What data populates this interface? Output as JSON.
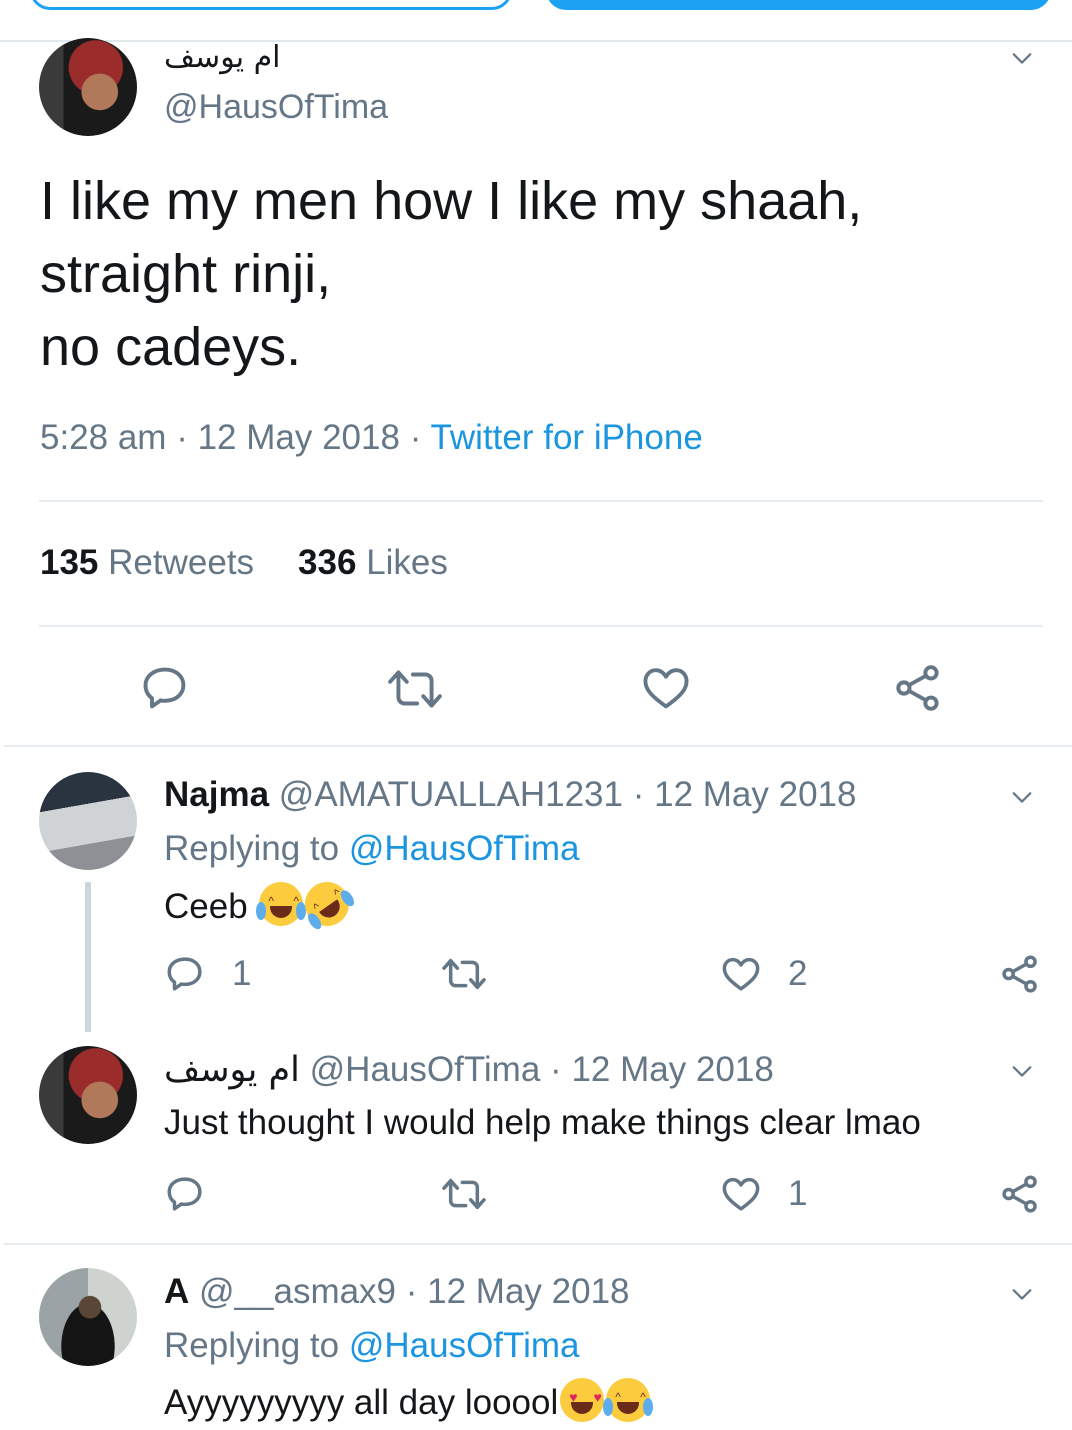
{
  "main_tweet": {
    "display_name": "ام يوسف",
    "handle": "@HausOfTima",
    "text": "I like my men how I like my shaah,\nstraight rinji,\nno cadeys.",
    "time": "5:28 am",
    "date": "12 May 2018",
    "source": "Twitter for iPhone",
    "retweets_count": "135",
    "retweets_label": "Retweets",
    "likes_count": "336",
    "likes_label": "Likes",
    "icons": [
      "reply-icon",
      "retweet-icon",
      "like-icon",
      "share-icon",
      "chevron-down-icon"
    ]
  },
  "replies": [
    {
      "display_name": "Najma",
      "handle": "@AMATUALLAH1231",
      "date": "12 May 2018",
      "replying_prefix": "Replying to",
      "replying_to": "@HausOfTima",
      "text": "Ceeb",
      "emojis": [
        "face-with-tears-of-joy",
        "rolling-on-the-floor-laughing"
      ],
      "reply_count": "1",
      "retweet_count": "",
      "like_count": "2"
    },
    {
      "display_name": "ام يوسف",
      "handle": "@HausOfTima",
      "date": "12 May 2018",
      "text": "Just thought I would help make things clear lmao",
      "reply_count": "",
      "retweet_count": "",
      "like_count": "1"
    },
    {
      "display_name": "A",
      "handle": "@__asmax9",
      "date": "12 May 2018",
      "replying_prefix": "Replying to",
      "replying_to": "@HausOfTima",
      "text": "Ayyyyyyyyy all day looool",
      "emojis": [
        "smiling-face-with-heart-eyes",
        "face-with-tears-of-joy"
      ]
    }
  ],
  "colors": {
    "accent": "#1da1f2",
    "link": "#1b95e0",
    "secondary_text": "#657786",
    "primary_text": "#14171a",
    "divider": "#e6ecf0"
  }
}
